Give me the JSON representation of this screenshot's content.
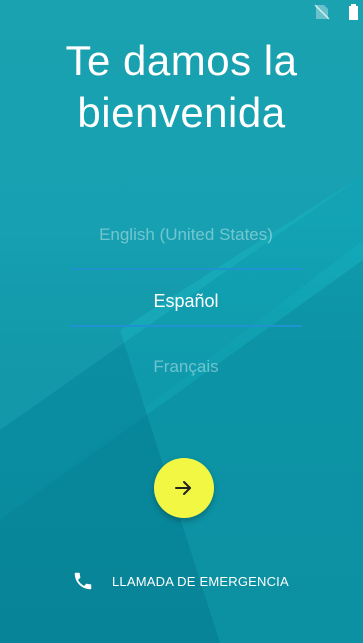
{
  "welcome": {
    "title_line1": "Te damos la",
    "title_line2": "bienvenida"
  },
  "languages": {
    "previous": "English (United States)",
    "selected": "Español",
    "next": "Français"
  },
  "actions": {
    "emergency_call_label": "LLAMADA DE EMERGENCIA"
  },
  "icons": {
    "status": [
      "no-sim-icon",
      "battery-icon"
    ],
    "next": "arrow-right-icon",
    "emergency": "phone-icon"
  },
  "colors": {
    "background": "#109eb2",
    "accent_button": "#f2f744",
    "divider": "#1f93cf"
  }
}
